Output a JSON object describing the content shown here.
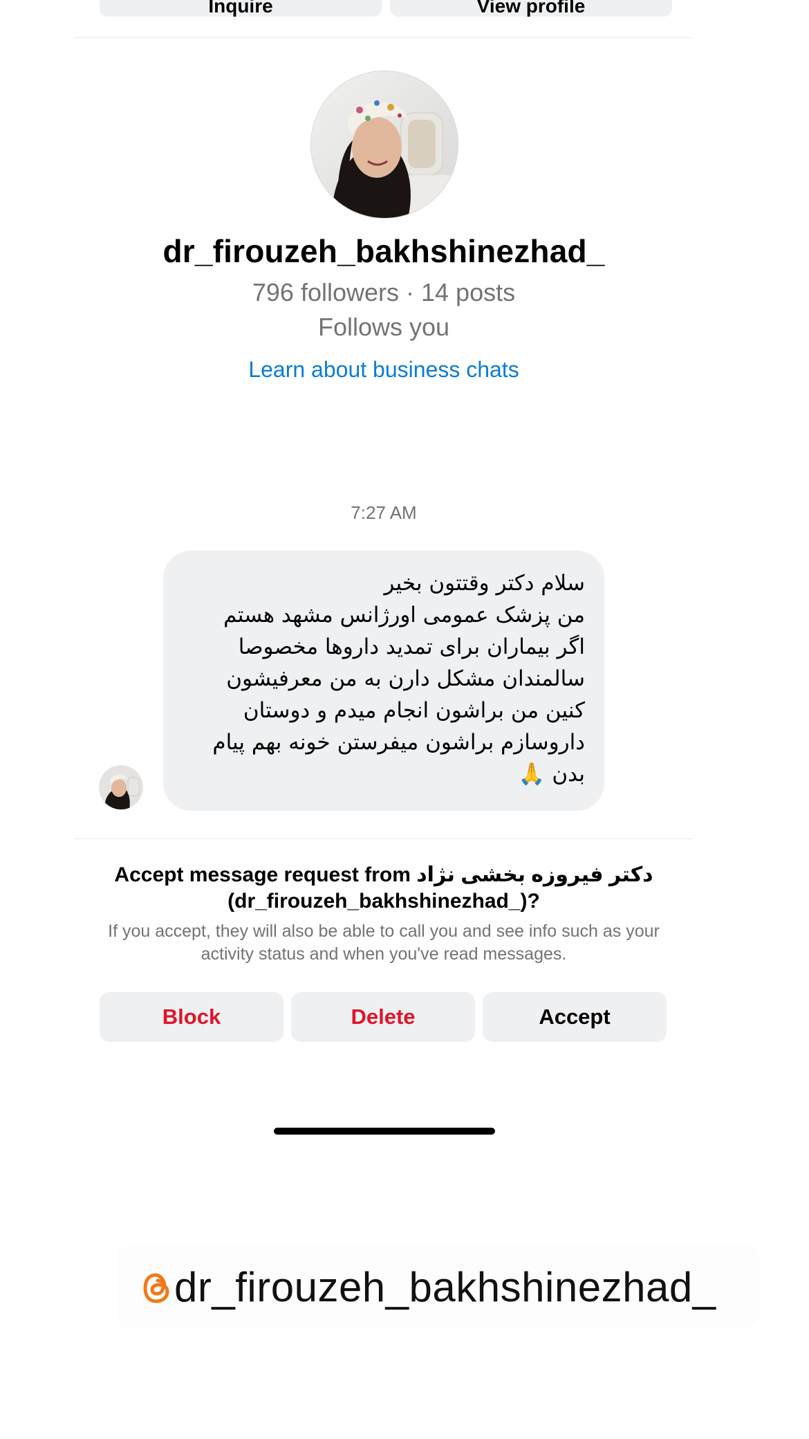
{
  "top_buttons": {
    "left_label": "Inquire",
    "right_label": "View profile"
  },
  "profile": {
    "username": "dr_firouzeh_bakhshinezhad_",
    "stats": "796 followers · 14 posts",
    "follows_you": "Follows you",
    "learn_link": "Learn about business chats"
  },
  "chat": {
    "timestamp": "7:27 AM",
    "message": "سلام دکتر وقتتون بخیر\nمن پزشک عمومی اورژانس مشهد هستم\nاگر بیماران برای تمدید داروها مخصوصا سالمندان مشکل دارن  به من معرفیشون کنین من براشون انجام میدم  و دوستان داروسازم براشون میفرستن خونه بهم پیام بدن 🙏"
  },
  "request": {
    "title_line1": "Accept message request from دکتر فیروزه بخشی نژاد",
    "title_line2": "(dr_firouzeh_bakhshinezhad_)?",
    "description": "If you accept, they will also be able to call you and see info such as your activity status and when you've read messages."
  },
  "actions": {
    "block": "Block",
    "delete": "Delete",
    "accept": "Accept"
  },
  "threads_tag": {
    "handle": "dr_firouzeh_bakhshinezhad_",
    "icon": "threads-icon"
  },
  "colors": {
    "danger": "#e0152a",
    "link": "#0a7cd6",
    "secondary_text": "#737373",
    "bubble_bg": "#eff0f2",
    "threads_orange": "#f07a1a"
  }
}
